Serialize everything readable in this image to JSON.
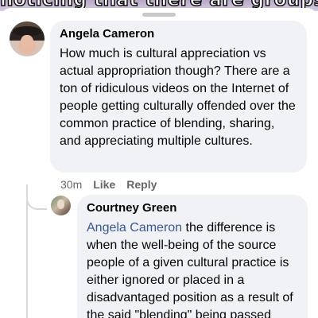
{
  "video_caption": "noticing that there are groups",
  "comments": [
    {
      "author": "Angela Cameron",
      "text": "How much is cultural appreciation vs actual appropriation though? There are a ton of ridiculous videos on the Internet of people getting culturally offended over the common practice of blending, sharing, and appreciating multiple cultures.",
      "time": "30m",
      "like_label": "Like",
      "reply_label": "Reply"
    }
  ],
  "replies": [
    {
      "author": "Courtney Green",
      "mention": "Angela Cameron",
      "text": " the difference is when the well-being of the source people of a given cultural practice is either ignored or placed in a disadvantaged position as a result of the said \"blending\" being passed"
    }
  ],
  "colors": {
    "bubble": "#f0f2f5",
    "mention": "#385898",
    "meta": "#65676b",
    "text": "#050505"
  }
}
